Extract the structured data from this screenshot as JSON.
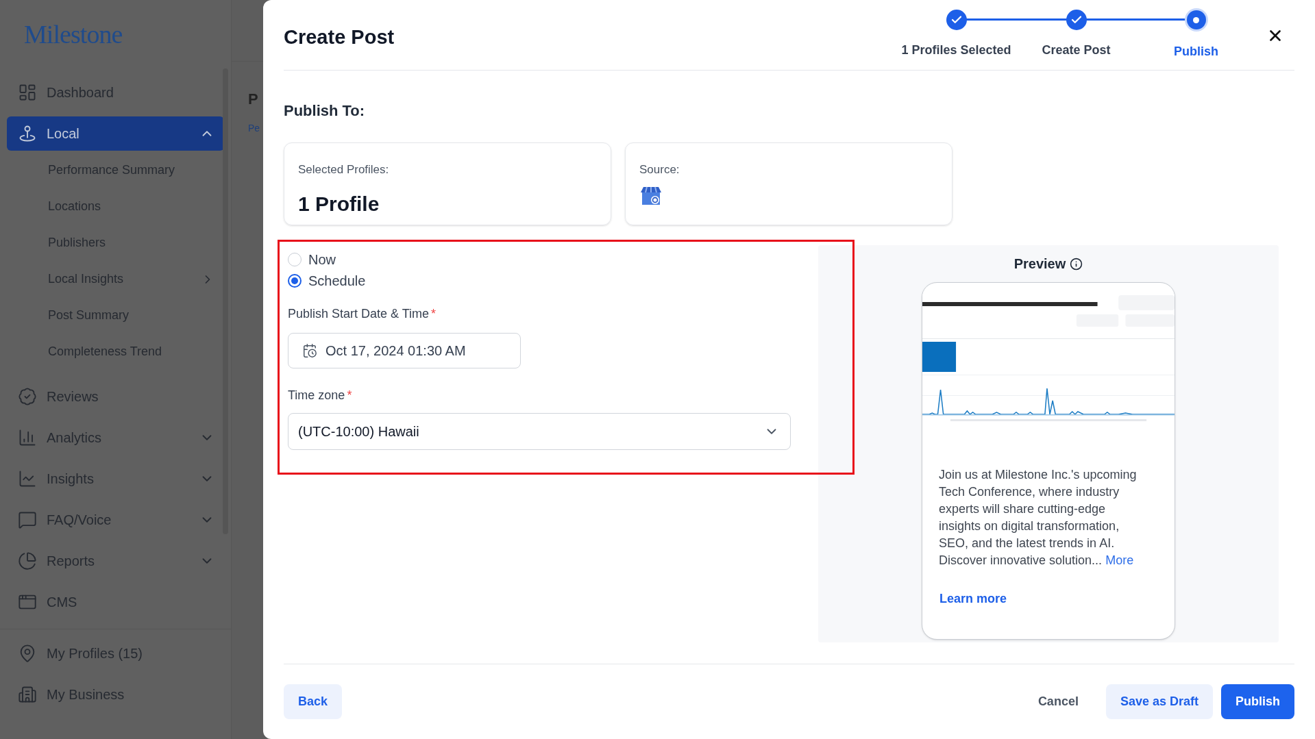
{
  "sidebar": {
    "logo": "Milestone",
    "items": [
      {
        "label": "Dashboard",
        "selected": false
      },
      {
        "label": "Local",
        "selected": true,
        "expanded": true,
        "children": [
          {
            "label": "Performance Summary",
            "kind": "link"
          },
          {
            "label": "Locations",
            "kind": "link"
          },
          {
            "label": "Publishers",
            "kind": "link"
          },
          {
            "label": "Local Insights",
            "kind": "submenu"
          },
          {
            "label": "Post Summary",
            "kind": "link"
          },
          {
            "label": "Completeness Trend",
            "kind": "link"
          }
        ]
      },
      {
        "label": "Reviews",
        "selected": false
      },
      {
        "label": "Analytics",
        "selected": false,
        "expanded": false
      },
      {
        "label": "Insights",
        "selected": false,
        "expanded": false
      },
      {
        "label": "FAQ/Voice",
        "selected": false,
        "expanded": false
      },
      {
        "label": "Reports",
        "selected": false,
        "expanded": false
      },
      {
        "label": "CMS",
        "selected": false
      }
    ],
    "footer_items": [
      {
        "label": "My Profiles (15)"
      },
      {
        "label": "My Business"
      }
    ]
  },
  "background_page": {
    "heading": "P",
    "link": "Pe"
  },
  "dialog": {
    "title": "Create Post",
    "steps": [
      {
        "label": "1 Profiles Selected",
        "kind": "done"
      },
      {
        "label": "Create Post",
        "kind": "done"
      },
      {
        "label": "Publish",
        "kind": "current"
      }
    ],
    "section_title": "Publish To:",
    "cards": [
      {
        "label": "Selected Profiles:",
        "value": "1 Profile"
      },
      {
        "label": "Source:"
      }
    ],
    "timing": [
      {
        "label": "Now",
        "selected": false
      },
      {
        "label": "Schedule",
        "selected": true
      }
    ],
    "start_label": "Publish Start Date & Time",
    "start_value": "Oct 17, 2024 01:30 AM",
    "timezone_label": "Time zone",
    "timezone_value": "(UTC-10:00) Hawaii",
    "required_mark": "*",
    "preview": {
      "title": "Preview",
      "body": "Join us at Milestone Inc.'s upcoming Tech Conference, where industry experts will share cutting-edge insights on digital transformation, SEO, and the latest trends in AI. Discover innovative solution...",
      "more": "More",
      "learn_more": "Learn more"
    },
    "buttons": {
      "back": "Back",
      "cancel": "Cancel",
      "draft": "Save as Draft",
      "publish": "Publish"
    }
  }
}
